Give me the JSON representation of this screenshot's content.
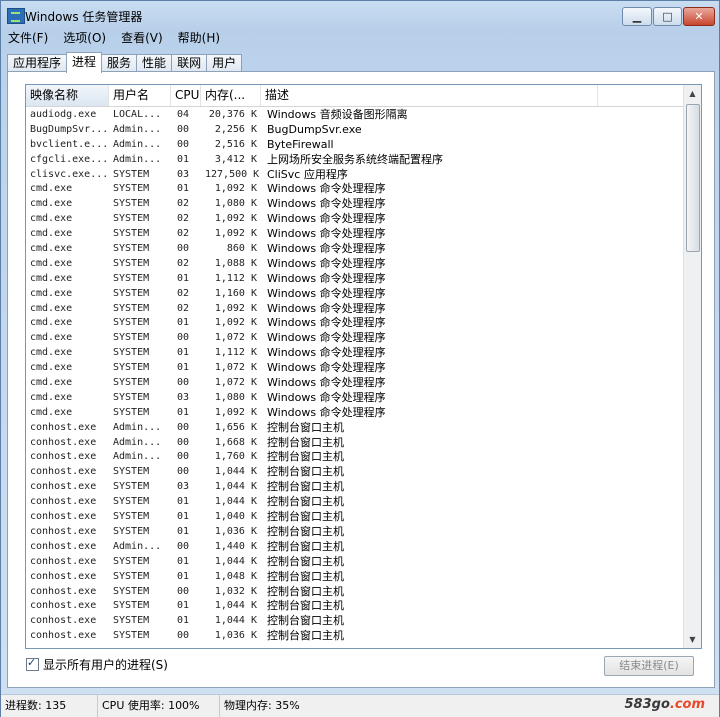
{
  "window": {
    "title": "Windows 任务管理器"
  },
  "menu": [
    "文件(F)",
    "选项(O)",
    "查看(V)",
    "帮助(H)"
  ],
  "tabs": [
    "应用程序",
    "进程",
    "服务",
    "性能",
    "联网",
    "用户"
  ],
  "active_tab": 1,
  "columns": {
    "name": "映像名称",
    "user": "用户名",
    "cpu": "CPU",
    "mem": "内存(...",
    "desc": "描述"
  },
  "rows": [
    {
      "name": "audiodg.exe",
      "user": "LOCAL...",
      "cpu": "04",
      "mem": "20,376 K",
      "desc": "Windows 音频设备图形隔离"
    },
    {
      "name": "BugDumpSvr...",
      "user": "Admin...",
      "cpu": "00",
      "mem": "2,256 K",
      "desc": "BugDumpSvr.exe"
    },
    {
      "name": "bvclient.e...",
      "user": "Admin...",
      "cpu": "00",
      "mem": "2,516 K",
      "desc": "ByteFirewall"
    },
    {
      "name": "cfgcli.exe...",
      "user": "Admin...",
      "cpu": "01",
      "mem": "3,412 K",
      "desc": "上网场所安全服务系统终端配置程序"
    },
    {
      "name": "clisvc.exe...",
      "user": "SYSTEM",
      "cpu": "03",
      "mem": "127,500 K",
      "desc": "CliSvc 应用程序"
    },
    {
      "name": "cmd.exe",
      "user": "SYSTEM",
      "cpu": "01",
      "mem": "1,092 K",
      "desc": "Windows 命令处理程序"
    },
    {
      "name": "cmd.exe",
      "user": "SYSTEM",
      "cpu": "02",
      "mem": "1,080 K",
      "desc": "Windows 命令处理程序"
    },
    {
      "name": "cmd.exe",
      "user": "SYSTEM",
      "cpu": "02",
      "mem": "1,092 K",
      "desc": "Windows 命令处理程序"
    },
    {
      "name": "cmd.exe",
      "user": "SYSTEM",
      "cpu": "02",
      "mem": "1,092 K",
      "desc": "Windows 命令处理程序"
    },
    {
      "name": "cmd.exe",
      "user": "SYSTEM",
      "cpu": "00",
      "mem": "860 K",
      "desc": "Windows 命令处理程序"
    },
    {
      "name": "cmd.exe",
      "user": "SYSTEM",
      "cpu": "02",
      "mem": "1,088 K",
      "desc": "Windows 命令处理程序"
    },
    {
      "name": "cmd.exe",
      "user": "SYSTEM",
      "cpu": "01",
      "mem": "1,112 K",
      "desc": "Windows 命令处理程序"
    },
    {
      "name": "cmd.exe",
      "user": "SYSTEM",
      "cpu": "02",
      "mem": "1,160 K",
      "desc": "Windows 命令处理程序"
    },
    {
      "name": "cmd.exe",
      "user": "SYSTEM",
      "cpu": "02",
      "mem": "1,092 K",
      "desc": "Windows 命令处理程序"
    },
    {
      "name": "cmd.exe",
      "user": "SYSTEM",
      "cpu": "01",
      "mem": "1,092 K",
      "desc": "Windows 命令处理程序"
    },
    {
      "name": "cmd.exe",
      "user": "SYSTEM",
      "cpu": "00",
      "mem": "1,072 K",
      "desc": "Windows 命令处理程序"
    },
    {
      "name": "cmd.exe",
      "user": "SYSTEM",
      "cpu": "01",
      "mem": "1,112 K",
      "desc": "Windows 命令处理程序"
    },
    {
      "name": "cmd.exe",
      "user": "SYSTEM",
      "cpu": "01",
      "mem": "1,072 K",
      "desc": "Windows 命令处理程序"
    },
    {
      "name": "cmd.exe",
      "user": "SYSTEM",
      "cpu": "00",
      "mem": "1,072 K",
      "desc": "Windows 命令处理程序"
    },
    {
      "name": "cmd.exe",
      "user": "SYSTEM",
      "cpu": "03",
      "mem": "1,080 K",
      "desc": "Windows 命令处理程序"
    },
    {
      "name": "cmd.exe",
      "user": "SYSTEM",
      "cpu": "01",
      "mem": "1,092 K",
      "desc": "Windows 命令处理程序"
    },
    {
      "name": "conhost.exe",
      "user": "Admin...",
      "cpu": "00",
      "mem": "1,656 K",
      "desc": "控制台窗口主机"
    },
    {
      "name": "conhost.exe",
      "user": "Admin...",
      "cpu": "00",
      "mem": "1,668 K",
      "desc": "控制台窗口主机"
    },
    {
      "name": "conhost.exe",
      "user": "Admin...",
      "cpu": "00",
      "mem": "1,760 K",
      "desc": "控制台窗口主机"
    },
    {
      "name": "conhost.exe",
      "user": "SYSTEM",
      "cpu": "00",
      "mem": "1,044 K",
      "desc": "控制台窗口主机"
    },
    {
      "name": "conhost.exe",
      "user": "SYSTEM",
      "cpu": "03",
      "mem": "1,044 K",
      "desc": "控制台窗口主机"
    },
    {
      "name": "conhost.exe",
      "user": "SYSTEM",
      "cpu": "01",
      "mem": "1,044 K",
      "desc": "控制台窗口主机"
    },
    {
      "name": "conhost.exe",
      "user": "SYSTEM",
      "cpu": "01",
      "mem": "1,040 K",
      "desc": "控制台窗口主机"
    },
    {
      "name": "conhost.exe",
      "user": "SYSTEM",
      "cpu": "01",
      "mem": "1,036 K",
      "desc": "控制台窗口主机"
    },
    {
      "name": "conhost.exe",
      "user": "Admin...",
      "cpu": "00",
      "mem": "1,440 K",
      "desc": "控制台窗口主机"
    },
    {
      "name": "conhost.exe",
      "user": "SYSTEM",
      "cpu": "01",
      "mem": "1,044 K",
      "desc": "控制台窗口主机"
    },
    {
      "name": "conhost.exe",
      "user": "SYSTEM",
      "cpu": "01",
      "mem": "1,048 K",
      "desc": "控制台窗口主机"
    },
    {
      "name": "conhost.exe",
      "user": "SYSTEM",
      "cpu": "00",
      "mem": "1,032 K",
      "desc": "控制台窗口主机"
    },
    {
      "name": "conhost.exe",
      "user": "SYSTEM",
      "cpu": "01",
      "mem": "1,044 K",
      "desc": "控制台窗口主机"
    },
    {
      "name": "conhost.exe",
      "user": "SYSTEM",
      "cpu": "01",
      "mem": "1,044 K",
      "desc": "控制台窗口主机"
    },
    {
      "name": "conhost.exe",
      "user": "SYSTEM",
      "cpu": "00",
      "mem": "1,036 K",
      "desc": "控制台窗口主机"
    }
  ],
  "show_all_label": "显示所有用户的进程(S)",
  "show_all_checked": true,
  "end_process_label": "结束进程(E)",
  "status": {
    "process_count": "进程数: 135",
    "cpu_usage": "CPU 使用率: 100%",
    "memory": "物理内存: 35%"
  },
  "watermark": {
    "main": "583go",
    "accent": ".com"
  }
}
